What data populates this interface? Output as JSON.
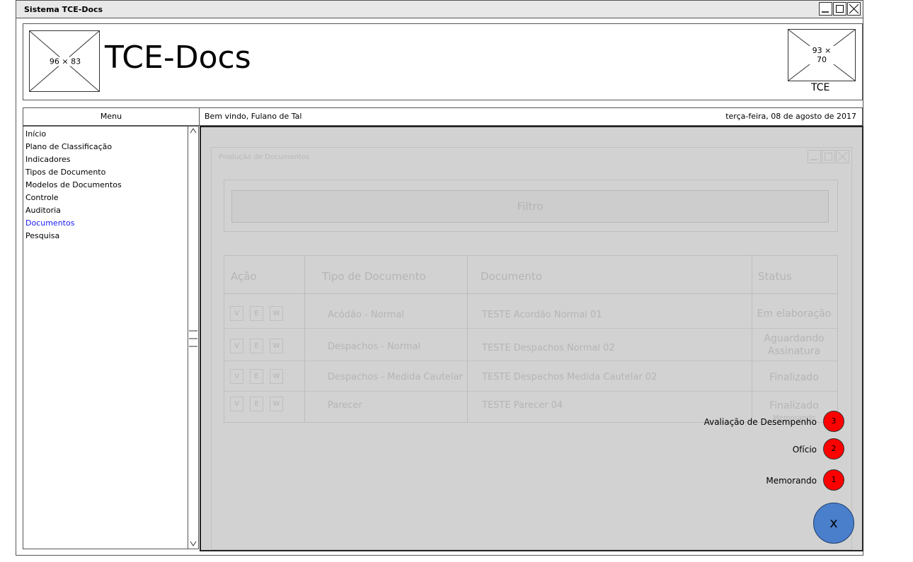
{
  "window": {
    "title": "Sistema TCE-Docs"
  },
  "header": {
    "logo_left_label": "96 × 83",
    "app_title": "TCE-Docs",
    "logo_right_label": "93 × 70",
    "logo_right_caption": "TCE"
  },
  "nav": {
    "menu_label": "Menu",
    "welcome": "Bem vindo, Fulano de Tal",
    "date": "terça-feira, 08 de agosto de 2017"
  },
  "sidebar": {
    "items": [
      {
        "label": "Início"
      },
      {
        "label": "Plano de Classificação"
      },
      {
        "label": "Indicadores"
      },
      {
        "label": "Tipos de Documento"
      },
      {
        "label": "Modelos de Documentos"
      },
      {
        "label": "Controle"
      },
      {
        "label": "Auditoria"
      },
      {
        "label": "Documentos"
      },
      {
        "label": "Pesquisa"
      }
    ],
    "active": "Documentos"
  },
  "panel": {
    "title": "Produção de Documentos",
    "filter_label": "Filtro",
    "table": {
      "headers": [
        "Ação",
        "Tipo de Documento",
        "Documento",
        "Status"
      ],
      "action_buttons": [
        "V",
        "E",
        "W"
      ],
      "rows": [
        {
          "tipo": "Acódão - Normal",
          "documento": "TESTE Acordão Normal 01",
          "status": "Em elaboração"
        },
        {
          "tipo": "Despachos - Normal",
          "documento": "TESTE Despachos Normal 02",
          "status": "Aguardando Assinatura"
        },
        {
          "tipo": "Despachos - Medida Cautelar",
          "documento": "TESTE Despachos Medida Cautelar 02",
          "status": "Finalizado"
        },
        {
          "tipo": "Parecer",
          "documento": "TESTE Parecer 04",
          "status": "Finalizado",
          "status_extra": "Memorando"
        }
      ]
    }
  },
  "fab": {
    "items": [
      {
        "label": "Avaliação de Desempenho",
        "count": "3"
      },
      {
        "label": "Ofício",
        "count": "2"
      },
      {
        "label": "Memorando",
        "count": "1"
      }
    ],
    "close_label": "x"
  },
  "colors": {
    "accent_link": "#1a1aff",
    "badge": "#ff0000",
    "fab": "#4a7fcb",
    "overlay": "#d2d2d2"
  }
}
